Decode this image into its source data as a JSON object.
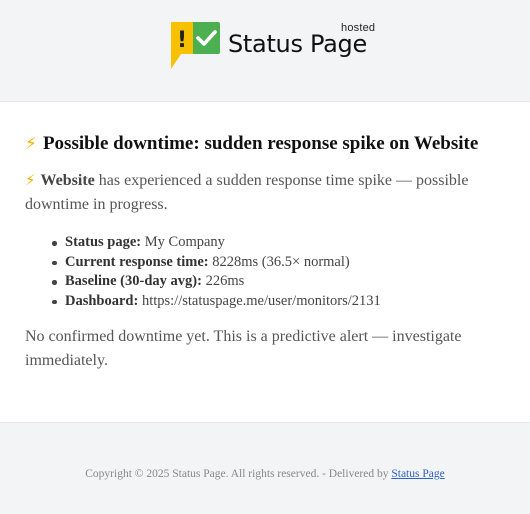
{
  "header": {
    "logo_mark": "!",
    "logo_text": "Status Page",
    "logo_hosted": "hosted",
    "colors": {
      "bubble_yellow": "#f7c100",
      "bubble_green": "#4caf50"
    }
  },
  "alert": {
    "icon": "lightning-bolt-icon",
    "icon_glyph": "⚡",
    "title": "Possible downtime: sudden response spike on Website",
    "intro_name": "Website",
    "intro_rest": "has experienced a sudden response time spike — possible downtime in progress.",
    "details": [
      {
        "label": "Status page:",
        "value": "My Company"
      },
      {
        "label": "Current response time:",
        "value": "8228ms (36.5× normal)"
      },
      {
        "label": "Baseline (30-day avg):",
        "value": "226ms"
      },
      {
        "label": "Dashboard:",
        "value": "https://statuspage.me/user/monitors/2131"
      }
    ],
    "closing": "No confirmed downtime yet. This is a predictive alert — investigate immediately."
  },
  "footer": {
    "copyright": "Copyright © 2025 Status Page. All rights reserved. - Delivered by",
    "link_label": "Status Page"
  }
}
